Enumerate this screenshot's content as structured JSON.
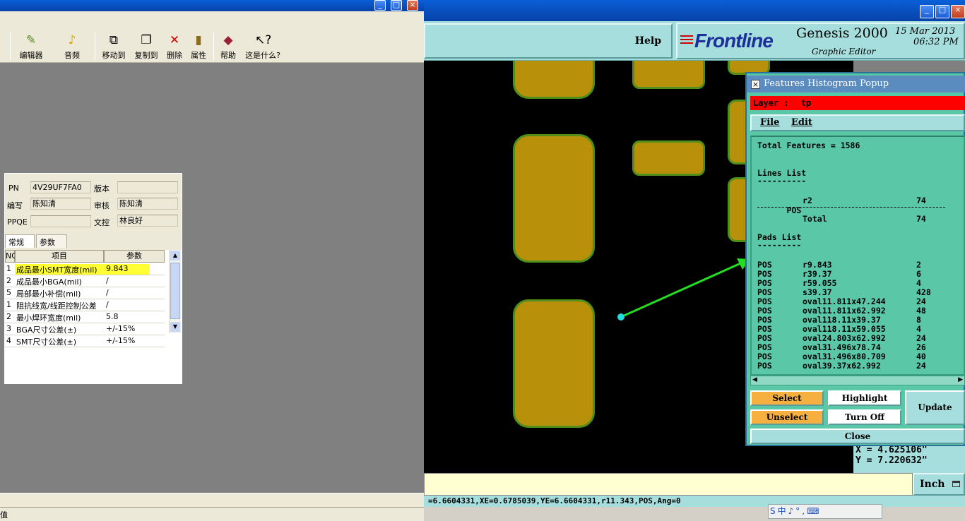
{
  "left_window": {
    "toolbar": [
      {
        "label": "编辑器",
        "icon": "editor-icon"
      },
      {
        "label": "音频",
        "icon": "audio-icon"
      },
      {
        "label": "移动到",
        "icon": "move-to-icon"
      },
      {
        "label": "复制到",
        "icon": "copy-to-icon"
      },
      {
        "label": "删除",
        "icon": "delete-icon"
      },
      {
        "label": "属性",
        "icon": "properties-icon"
      },
      {
        "label": "帮助",
        "icon": "help-book-icon"
      },
      {
        "label": "这是什么?",
        "icon": "whats-this-icon"
      }
    ],
    "form": {
      "pn_label": "PN",
      "pn_value": "4V29UF7FA0",
      "version_label": "版本",
      "version_value": "",
      "author_label": "编写",
      "author_value": "陈知清",
      "review_label": "审核",
      "review_value": "陈知清",
      "ppqe_label": "PPQE",
      "ppqe_value": "",
      "doc_label": "文控",
      "doc_value": "林良好"
    },
    "tabs": [
      "常规",
      "参数"
    ],
    "grid": {
      "headers": [
        "NO",
        "项目",
        "参数"
      ],
      "rows": [
        {
          "no": "1",
          "item": "成品最小SMT宽度(mil)",
          "value": "9.843"
        },
        {
          "no": "2",
          "item": "成品最小BGA(mil)",
          "value": "/"
        },
        {
          "no": "5",
          "item": "局部最小补偿(mil)",
          "value": "/"
        },
        {
          "no": "1",
          "item": "阻抗线宽/线距控制公差",
          "value": "/"
        },
        {
          "no": "2",
          "item": "最小焊环宽度(mil)",
          "value": "5.8"
        },
        {
          "no": "3",
          "item": "BGA尺寸公差(±)",
          "value": "+/-15%"
        },
        {
          "no": "4",
          "item": "SMT尺寸公差(±)",
          "value": "+/-15%"
        }
      ]
    },
    "status_text": "值"
  },
  "right_window": {
    "help_label": "Help",
    "brand": {
      "logo": "Frontline",
      "product": "Genesis 2000",
      "subtitle": "Graphic Editor",
      "date": "15 Mar 2013",
      "time": "06:32 PM"
    },
    "coords": {
      "x": "X  =  4.625106\"",
      "y": "Y  =  7.220632\""
    },
    "units_label": "Inch",
    "status_line": "=6.6604331,XE=0.6785039,YE=6.6604331,r11.343,POS,Ang=0",
    "ime_text": "S中♪°,⌨"
  },
  "popup": {
    "title": "Features Histogram Popup",
    "layer_label": "Layer :",
    "layer_value": "tp",
    "menu_file": "File",
    "menu_edit": "Edit",
    "total_line": "Total Features = 1586",
    "lines_header": "Lines List",
    "underline_short": "----------",
    "lines": [
      {
        "pol": "POS",
        "sym": "r2",
        "count": "74"
      }
    ],
    "total_label": "Total",
    "total_count": "74",
    "pads_header": "Pads List",
    "pads_underline": "---------",
    "pads": [
      {
        "pol": "POS",
        "sym": "r9.843",
        "count": "2"
      },
      {
        "pol": "POS",
        "sym": "r39.37",
        "count": "6"
      },
      {
        "pol": "POS",
        "sym": "r59.055",
        "count": "4"
      },
      {
        "pol": "POS",
        "sym": "s39.37",
        "count": "428"
      },
      {
        "pol": "POS",
        "sym": "oval11.811x47.244",
        "count": "24"
      },
      {
        "pol": "POS",
        "sym": "oval11.811x62.992",
        "count": "48"
      },
      {
        "pol": "POS",
        "sym": "oval118.11x39.37",
        "count": "8"
      },
      {
        "pol": "POS",
        "sym": "oval118.11x59.055",
        "count": "4"
      },
      {
        "pol": "POS",
        "sym": "oval24.803x62.992",
        "count": "24"
      },
      {
        "pol": "POS",
        "sym": "oval31.496x78.74",
        "count": "26"
      },
      {
        "pol": "POS",
        "sym": "oval31.496x80.709",
        "count": "40"
      },
      {
        "pol": "POS",
        "sym": "oval39.37x62.992",
        "count": "24"
      }
    ],
    "buttons": {
      "select": "Select",
      "highlight": "Highlight",
      "unselect": "Unselect",
      "turn_off": "Turn Off",
      "update": "Update",
      "close": "Close"
    }
  }
}
